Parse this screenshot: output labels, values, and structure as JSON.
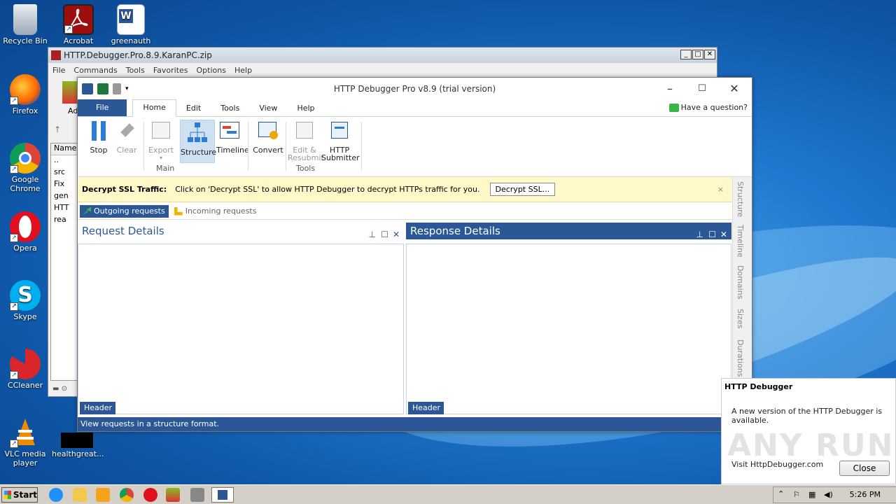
{
  "desktop": {
    "icons": [
      {
        "label": "Recycle Bin"
      },
      {
        "label": "Acrobat"
      },
      {
        "label": "greenauth"
      },
      {
        "label": "Firefox"
      },
      {
        "label": "Google Chrome"
      },
      {
        "label": "Opera"
      },
      {
        "label": "Skype"
      },
      {
        "label": "CCleaner"
      },
      {
        "label": "VLC media player"
      },
      {
        "label": "healthgreat..."
      }
    ]
  },
  "winrar": {
    "title": "HTTP.Debugger.Pro.8.9.KaranPC.zip",
    "menu": [
      "File",
      "Commands",
      "Tools",
      "Favorites",
      "Options",
      "Help"
    ],
    "toolbar_label": "Ad",
    "column_header": "Name",
    "files": [
      "..",
      "src",
      "Fix",
      "gen",
      "HTT",
      "rea"
    ]
  },
  "debugger": {
    "title": "HTTP Debugger Pro v8.9 (trial version)",
    "tabs": [
      "File",
      "Home",
      "Edit",
      "Tools",
      "View",
      "Help"
    ],
    "active_tab": "Home",
    "help_link": "Have a question?",
    "ribbon": {
      "stop": "Stop",
      "clear": "Clear",
      "export": "Export",
      "structure": "Structure",
      "timeline": "Timeline",
      "convert": "Convert",
      "edit_resubmit": "Edit &",
      "edit_resubmit2": "Resubmit",
      "http_submitter": "HTTP",
      "http_submitter2": "Submitter",
      "group_main": "Main",
      "group_tools": "Tools"
    },
    "ssl_bar": {
      "title": "Decrypt SSL Traffic:",
      "message": "Click on 'Decrypt SSL' to allow HTTP Debugger to decrypt HTTPs traffic for you.",
      "button": "Decrypt SSL...",
      "close": "×"
    },
    "subtabs": {
      "outgoing": "Outgoing requests",
      "incoming": "Incoming requests"
    },
    "request_pane": {
      "title": "Request Details",
      "header_btn": "Header"
    },
    "response_pane": {
      "title": "Response Details",
      "header_btn": "Header"
    },
    "side_tabs": [
      "Structure",
      "Timeline",
      "Domains",
      "Sizes",
      "Durations"
    ],
    "status": "View requests in a structure format."
  },
  "notification": {
    "title": "HTTP Debugger",
    "body": "A new version of the HTTP Debugger is available.",
    "link": "Visit HttpDebugger.com",
    "close": "Close",
    "watermark": "ANY RUN"
  },
  "taskbar": {
    "start": "Start",
    "clock": "5:26 PM"
  },
  "colors": {
    "accent": "#2b5797",
    "ssl_bar": "#fff8c8"
  }
}
